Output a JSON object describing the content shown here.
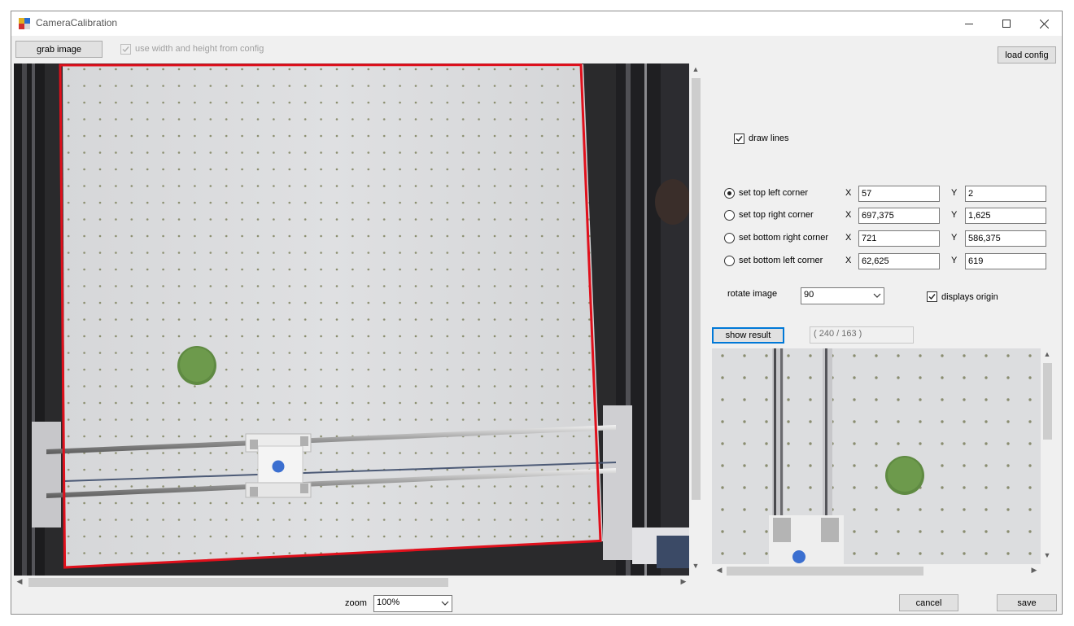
{
  "window": {
    "title": "CameraCalibration"
  },
  "toolbar": {
    "grab_image_label": "grab image",
    "use_config_label": "use width and height from config",
    "load_config_label": "load config"
  },
  "draw_lines_label": "draw lines",
  "corners": [
    {
      "label": "set top left corner",
      "x_label": "X",
      "x": "57",
      "y_label": "Y",
      "y": "2",
      "selected": true
    },
    {
      "label": "set top right corner",
      "x_label": "X",
      "x": "697,375",
      "y_label": "Y",
      "y": "1,625",
      "selected": false
    },
    {
      "label": "set bottom right corner",
      "x_label": "X",
      "x": "721",
      "y_label": "Y",
      "y": "586,375",
      "selected": false
    },
    {
      "label": "set bottom left corner",
      "x_label": "X",
      "x": "62,625",
      "y_label": "Y",
      "y": "619",
      "selected": false
    }
  ],
  "rotate": {
    "label": "rotate image",
    "value": "90"
  },
  "displays_origin_label": "displays origin",
  "show_result_label": "show result",
  "coords_readout": "( 240 / 163 )",
  "zoom": {
    "label": "zoom",
    "value": "100%"
  },
  "footer": {
    "cancel_label": "cancel",
    "save_label": "save"
  },
  "colors": {
    "calibration_outline": "#e0101c",
    "focus_blue": "#0078d7",
    "puck_green": "#6d9a4c"
  },
  "icons": [
    "app-icon",
    "minimize-icon",
    "maximize-icon",
    "close-icon",
    "checkmark-icon",
    "chevron-down-icon",
    "scroll-up-icon",
    "scroll-down-icon",
    "scroll-left-icon",
    "scroll-right-icon"
  ]
}
